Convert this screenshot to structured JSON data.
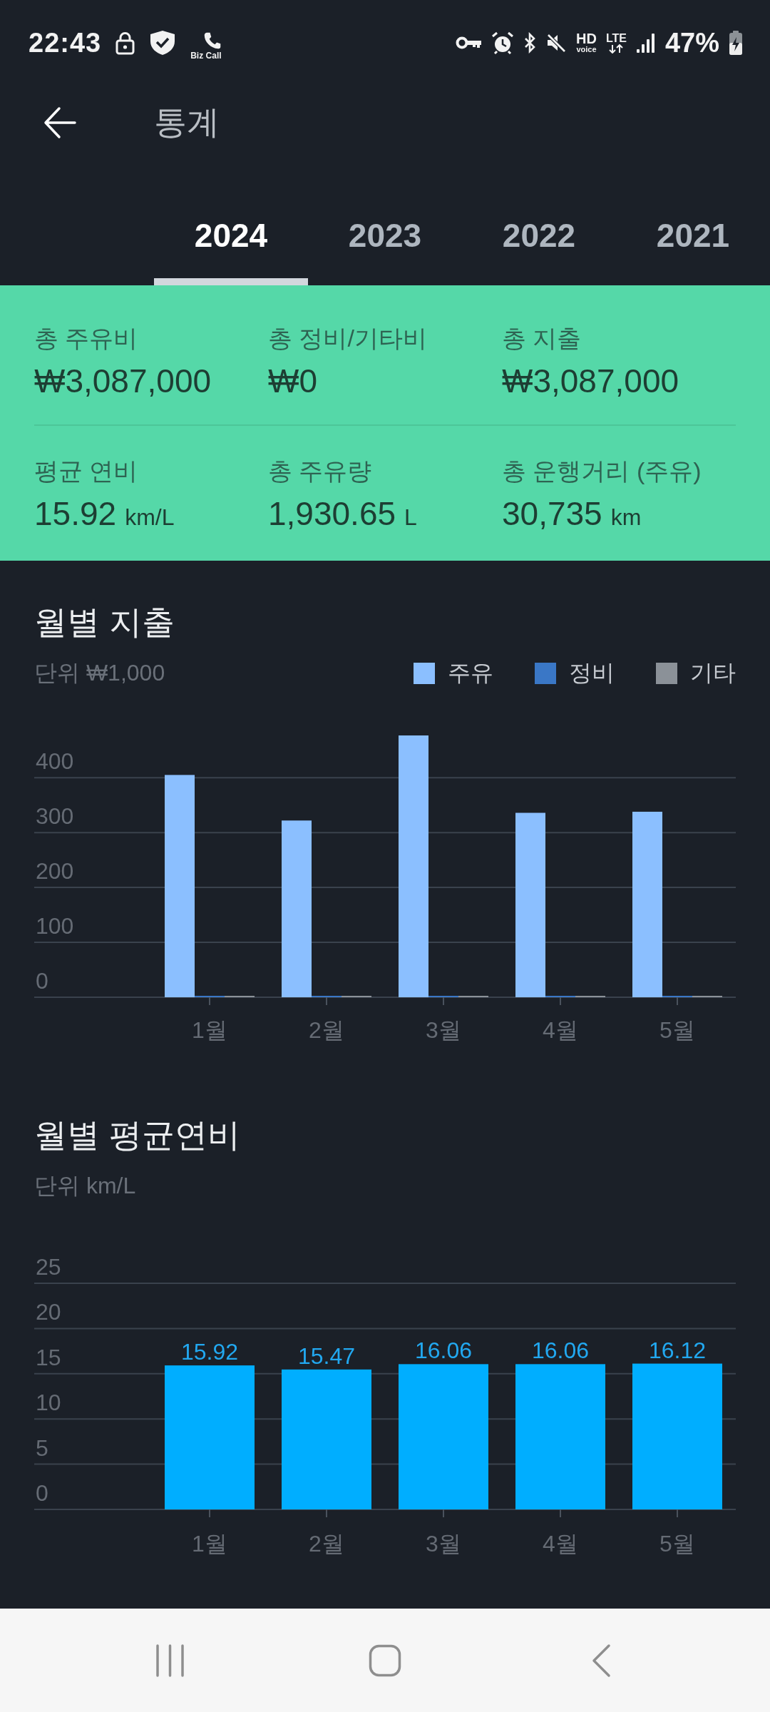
{
  "status_bar": {
    "time": "22:43",
    "biz_call": "Biz Call",
    "hd": "HD",
    "voice": "voice",
    "network": "LTE",
    "battery": "47%"
  },
  "app_bar": {
    "title": "통계"
  },
  "tabs": [
    {
      "label": "2024",
      "selected": true
    },
    {
      "label": "2023",
      "selected": false
    },
    {
      "label": "2022",
      "selected": false
    },
    {
      "label": "2021",
      "selected": false
    }
  ],
  "summary": {
    "rows": [
      {
        "items": [
          {
            "label": "총 주유비",
            "value": "₩3,087,000"
          },
          {
            "label": "총 정비/기타비",
            "value": "₩0"
          },
          {
            "label": "총 지출",
            "value": "₩3,087,000"
          }
        ]
      },
      {
        "items": [
          {
            "label": "평균 연비",
            "value": "15.92",
            "unit": "km/L"
          },
          {
            "label": "총 주유량",
            "value": "1,930.65",
            "unit": "L"
          },
          {
            "label": "총 운행거리 (주유)",
            "value": "30,735",
            "unit": "km"
          }
        ]
      }
    ]
  },
  "charts": [
    {
      "title": "월별 지출",
      "unit_label": "단위 ₩1,000",
      "chart_data": {
        "type": "bar",
        "categories": [
          "1월",
          "2월",
          "3월",
          "4월",
          "5월"
        ],
        "series": [
          {
            "name": "주유",
            "color": "#8bbfff",
            "values": [
              405,
              322,
              477,
              336,
              338
            ]
          },
          {
            "name": "정비",
            "color": "#3a77c6",
            "values": [
              0,
              0,
              0,
              0,
              0
            ]
          },
          {
            "name": "기타",
            "color": "#8b9198",
            "values": [
              0,
              0,
              0,
              0,
              0
            ]
          }
        ],
        "ylim": [
          0,
          477
        ],
        "yticks": [
          0,
          100,
          200,
          300,
          400
        ],
        "grid": true
      }
    },
    {
      "title": "월별 평균연비",
      "unit_label": "단위 km/L",
      "chart_data": {
        "type": "bar",
        "categories": [
          "1월",
          "2월",
          "3월",
          "4월",
          "5월"
        ],
        "values": [
          15.92,
          15.47,
          16.06,
          16.06,
          16.12
        ],
        "ylim": [
          0,
          25
        ],
        "yticks": [
          0,
          5,
          10,
          15,
          20,
          25
        ],
        "grid": true,
        "value_labels": [
          "15.92",
          "15.47",
          "16.06",
          "16.06",
          "16.12"
        ]
      }
    }
  ]
}
